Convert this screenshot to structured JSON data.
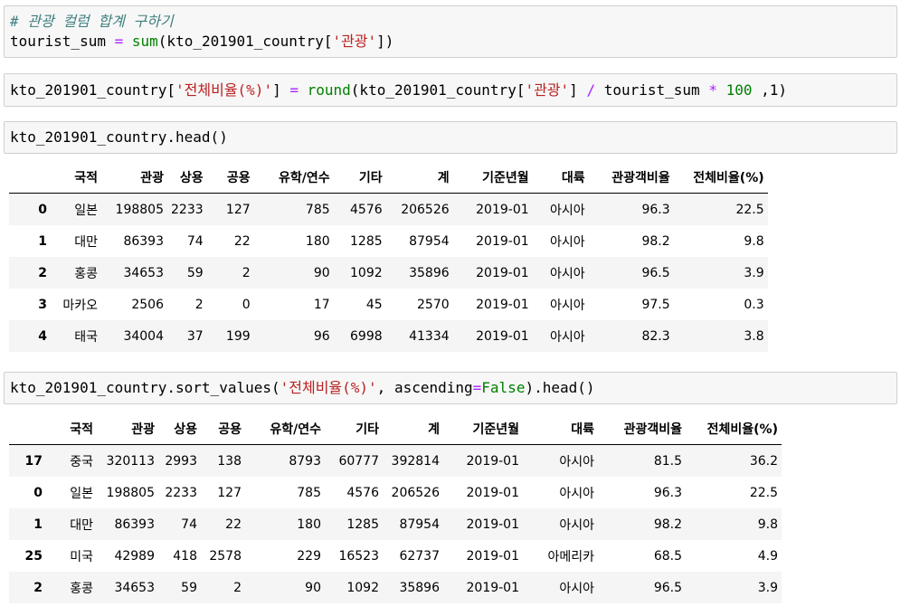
{
  "cells": [
    {
      "comment": "# 관광 컬럼 합계 구하기",
      "line2": {
        "var": "tourist_sum",
        "op": "=",
        "fn": "sum",
        "open": "(kto_201901_country[",
        "str": "'관광'",
        "close": "])"
      }
    },
    {
      "part1": "kto_201901_country[",
      "str1": "'전체비율(%)'",
      "part2": "] ",
      "op1": "=",
      "fn": "round",
      "part3": "(kto_201901_country[",
      "str2": "'관광'",
      "part4": "] ",
      "op2": "/",
      "part5": " tourist_sum ",
      "op3": "*",
      "num": "100",
      "part6": " ,1)"
    },
    {
      "code": "kto_201901_country.head()"
    },
    {
      "part1": "kto_201901_country.sort_values(",
      "str": "'전체비율(%)'",
      "part2": ", ascending",
      "op": "=",
      "kw": "False",
      "part3": ").head()"
    }
  ],
  "columns": [
    "국적",
    "관광",
    "상용",
    "공용",
    "유학/연수",
    "기타",
    "계",
    "기준년월",
    "대륙",
    "관광객비율",
    "전체비율(%)"
  ],
  "table1": [
    {
      "idx": "0",
      "vals": [
        "일본",
        "198805",
        "2233",
        "127",
        "785",
        "4576",
        "206526",
        "2019-01",
        "아시아",
        "96.3",
        "22.5"
      ]
    },
    {
      "idx": "1",
      "vals": [
        "대만",
        "86393",
        "74",
        "22",
        "180",
        "1285",
        "87954",
        "2019-01",
        "아시아",
        "98.2",
        "9.8"
      ]
    },
    {
      "idx": "2",
      "vals": [
        "홍콩",
        "34653",
        "59",
        "2",
        "90",
        "1092",
        "35896",
        "2019-01",
        "아시아",
        "96.5",
        "3.9"
      ]
    },
    {
      "idx": "3",
      "vals": [
        "마카오",
        "2506",
        "2",
        "0",
        "17",
        "45",
        "2570",
        "2019-01",
        "아시아",
        "97.5",
        "0.3"
      ]
    },
    {
      "idx": "4",
      "vals": [
        "태국",
        "34004",
        "37",
        "199",
        "96",
        "6998",
        "41334",
        "2019-01",
        "아시아",
        "82.3",
        "3.8"
      ]
    }
  ],
  "table2": [
    {
      "idx": "17",
      "vals": [
        "중국",
        "320113",
        "2993",
        "138",
        "8793",
        "60777",
        "392814",
        "2019-01",
        "아시아",
        "81.5",
        "36.2"
      ]
    },
    {
      "idx": "0",
      "vals": [
        "일본",
        "198805",
        "2233",
        "127",
        "785",
        "4576",
        "206526",
        "2019-01",
        "아시아",
        "96.3",
        "22.5"
      ]
    },
    {
      "idx": "1",
      "vals": [
        "대만",
        "86393",
        "74",
        "22",
        "180",
        "1285",
        "87954",
        "2019-01",
        "아시아",
        "98.2",
        "9.8"
      ]
    },
    {
      "idx": "25",
      "vals": [
        "미국",
        "42989",
        "418",
        "2578",
        "229",
        "16523",
        "62737",
        "2019-01",
        "아메리카",
        "68.5",
        "4.9"
      ]
    },
    {
      "idx": "2",
      "vals": [
        "홍콩",
        "34653",
        "59",
        "2",
        "90",
        "1092",
        "35896",
        "2019-01",
        "아시아",
        "96.5",
        "3.9"
      ]
    }
  ]
}
